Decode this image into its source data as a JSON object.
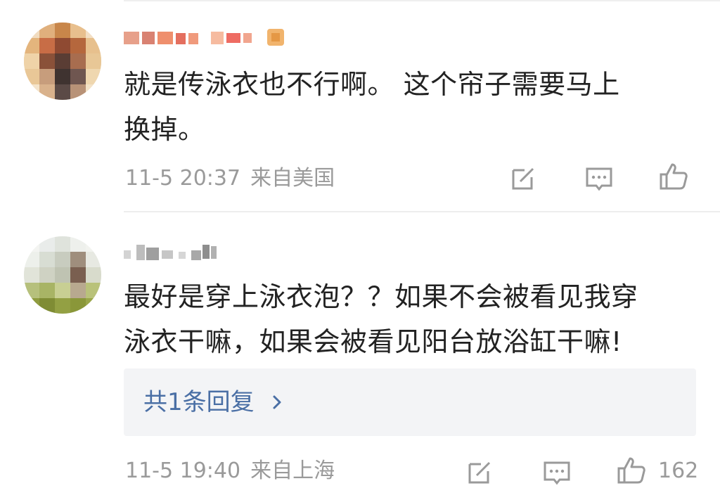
{
  "comments": [
    {
      "content_lines": [
        "就是传泳衣也不行啊。  这个帘子需要马上",
        "换掉。"
      ],
      "time": "11-5 20:37",
      "location": "来自美国",
      "like_count": ""
    },
    {
      "content_lines": [
        "最好是穿上泳衣泡？？如果不会被看见我穿",
        "泳衣干嘛，如果会被看见阳台放浴缸干嘛!"
      ],
      "reply_summary": "共1条回复",
      "time": "11-5 19:40",
      "location": "来自上海",
      "like_count": "162"
    }
  ],
  "icons": {
    "edit": "share-edit-icon",
    "comment": "comment-icon",
    "like": "thumbs-up-icon",
    "chevron": "chevron-right-icon"
  },
  "colors": {
    "text_primary": "#222222",
    "text_meta": "#9a9a9a",
    "link": "#4a6fa5",
    "reply_bg": "#f3f4f6",
    "divider": "#ededed"
  }
}
